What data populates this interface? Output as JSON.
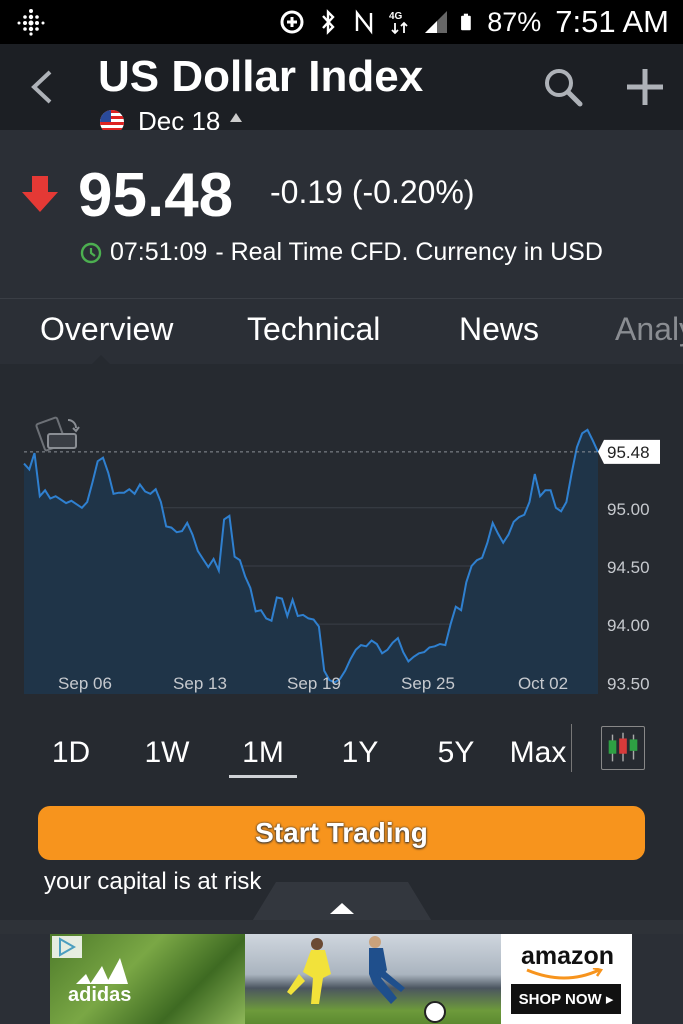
{
  "status_bar": {
    "battery": "87%",
    "time": "7:51 AM",
    "network_badge": "4G"
  },
  "header": {
    "title": "US Dollar Index",
    "subtitle": "Dec 18"
  },
  "quote": {
    "price": "95.48",
    "change": "-0.19 (-0.20%)",
    "time": "07:51:09",
    "description": "- Real Time CFD. Currency in USD",
    "direction_color": "#e53935",
    "clock_color": "#4caf50"
  },
  "tabs": [
    {
      "label": "Overview"
    },
    {
      "label": "Technical"
    },
    {
      "label": "News"
    },
    {
      "label": "Analy"
    }
  ],
  "chart_data": {
    "type": "area",
    "x_ticks": [
      "Sep 06",
      "Sep 13",
      "Sep 19",
      "Sep 25",
      "Oct 02"
    ],
    "y_ticks": [
      "95.00",
      "94.50",
      "94.00",
      "93.50"
    ],
    "current_label": "95.48",
    "ylim": [
      93.4,
      95.72
    ],
    "line_color": "#2f80d0",
    "fill_color": "#1f3448",
    "points": [
      95.38,
      95.33,
      95.47,
      95.1,
      95.15,
      95.08,
      95.1,
      95.07,
      95.04,
      95.06,
      95.03,
      95.0,
      95.05,
      95.22,
      95.4,
      95.43,
      95.3,
      95.12,
      95.13,
      95.13,
      95.16,
      95.12,
      95.2,
      95.14,
      95.12,
      95.16,
      95.05,
      94.84,
      94.83,
      94.79,
      94.8,
      94.87,
      94.77,
      94.63,
      94.56,
      94.49,
      94.56,
      94.46,
      94.9,
      94.93,
      94.58,
      94.55,
      94.41,
      94.31,
      94.11,
      94.12,
      94.05,
      94.03,
      94.23,
      94.22,
      94.07,
      94.21,
      94.07,
      94.08,
      94.05,
      94.04,
      93.98,
      93.6,
      93.52,
      93.5,
      93.53,
      93.6,
      93.7,
      93.78,
      93.82,
      93.81,
      93.86,
      93.83,
      93.75,
      93.78,
      93.84,
      93.88,
      93.76,
      93.68,
      93.72,
      93.75,
      93.76,
      93.8,
      93.81,
      93.83,
      93.82,
      94.0,
      94.15,
      94.12,
      94.36,
      94.5,
      94.55,
      94.57,
      94.7,
      94.87,
      94.78,
      94.7,
      94.77,
      94.88,
      94.92,
      94.94,
      95.05,
      95.29,
      95.1,
      95.15,
      95.15,
      95.0,
      94.97,
      95.05,
      95.3,
      95.52,
      95.64,
      95.67,
      95.58,
      95.48
    ]
  },
  "ranges": [
    {
      "label": "1D"
    },
    {
      "label": "1W"
    },
    {
      "label": "1M"
    },
    {
      "label": "1Y"
    },
    {
      "label": "5Y"
    },
    {
      "label": "Max"
    }
  ],
  "selected_range": "1M",
  "cta": {
    "label": "Start Trading",
    "risk_text": "your capital is at risk",
    "color": "#f7941d"
  },
  "ad": {
    "brand_left": "adidas",
    "brand_right": "amazon",
    "shop_label": "SHOP NOW ▸"
  }
}
